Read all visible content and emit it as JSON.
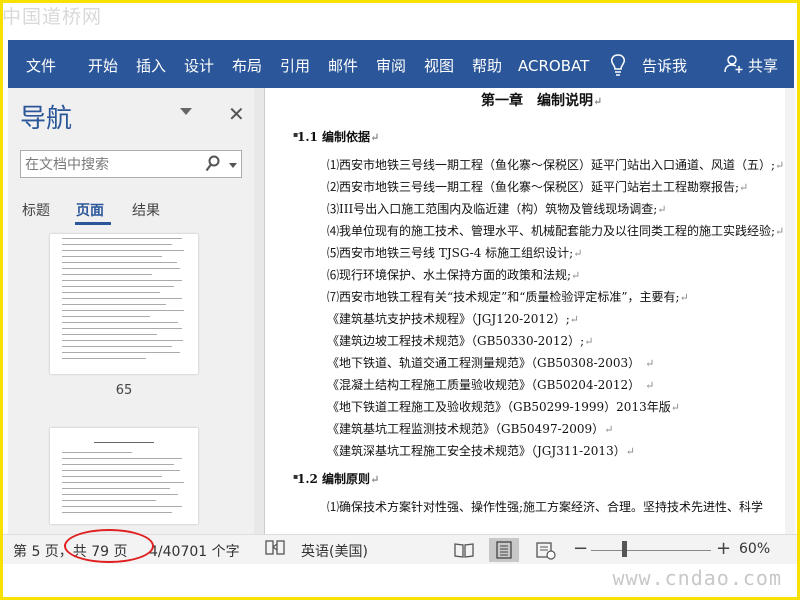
{
  "watermark": {
    "top": "中国道桥网",
    "bottom": "www.cndao.com"
  },
  "ribbon": {
    "tabs": [
      "文件",
      "开始",
      "插入",
      "设计",
      "布局",
      "引用",
      "邮件",
      "审阅",
      "视图",
      "帮助",
      "ACROBAT"
    ],
    "tell_me": "告诉我",
    "share": "共享",
    "color": "#2b579a"
  },
  "nav": {
    "title": "导航",
    "search_placeholder": "在文档中搜索",
    "tabs": [
      "标题",
      "页面",
      "结果"
    ],
    "active_tab": "页面",
    "thumb_page_label": "65"
  },
  "document": {
    "chapter_title": "第一章　编制说明",
    "section1": "1.1 编制依据",
    "items": [
      "⑴西安市地铁三号线一期工程（鱼化寨～保税区）延平门站出入口通道、风道（五）;",
      "⑵西安市地铁三号线一期工程（鱼化寨～保税区）延平门站岩土工程勘察报告;",
      "⑶III号出入口施工范围内及临近建（构）筑物及管线现场调查;",
      "⑷我单位现有的施工技术、管理水平、机械配套能力及以往同类工程的施工实践经验;",
      "⑸西安市地铁三号线 TJSG-4 标施工组织设计;",
      "⑹现行环境保护、水土保持方面的政策和法规;",
      "⑺西安市地铁工程有关“技术规定”和“质量检验评定标准”，主要有;",
      "《建筑基坑支护技术规程》（JGJ120-2012）;",
      "《建筑边坡工程技术规范》（GB50330-2012）;",
      "《地下铁道、轨道交通工程测量规范》（GB50308-2003）",
      "《混凝土结构工程施工质量验收规范》（GB50204-2012）",
      "《地下铁道工程施工及验收规范》（GB50299-1999）2013年版",
      "《建筑基坑工程监测技术规范》（GB50497-2009）",
      "《建筑深基坑工程施工安全技术规范》（JGJ311-2013）"
    ],
    "section2": "1.2 编制原则",
    "section2_item": "⑴确保技术方案针对性强、操作性强;施工方案经济、合理。坚持技术先进性、科学"
  },
  "status": {
    "page": "第 5 页，共 79 页",
    "words": "4/40701 个字",
    "language": "英语(美国)",
    "zoom": "60%",
    "zoom_level_percent": 60
  }
}
